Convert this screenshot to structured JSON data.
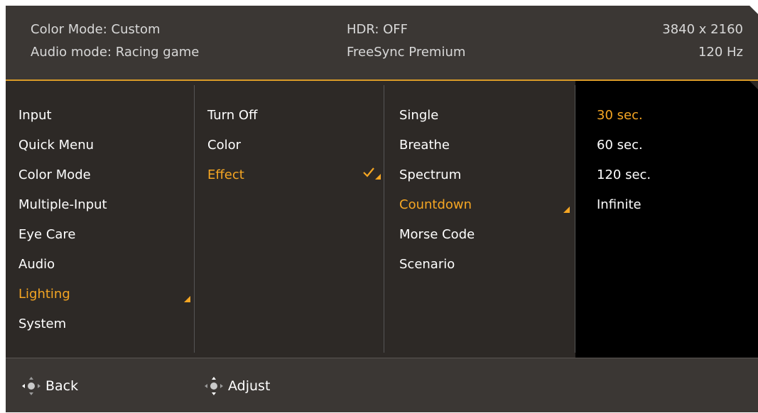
{
  "header": {
    "color_mode": "Color Mode: Custom",
    "audio_mode": "Audio mode: Racing game",
    "hdr": "HDR: OFF",
    "freesync": "FreeSync Premium",
    "resolution": "3840 x 2160",
    "refresh": "120 Hz"
  },
  "menu": {
    "main": [
      "Input",
      "Quick Menu",
      "Color Mode",
      "Multiple-Input",
      "Eye Care",
      "Audio",
      "Lighting",
      "System"
    ],
    "main_selected": "Lighting",
    "lighting": [
      "Turn Off",
      "Color",
      "Effect"
    ],
    "lighting_selected": "Effect",
    "effect": [
      "Single",
      "Breathe",
      "Spectrum",
      "Countdown",
      "Morse Code",
      "Scenario"
    ],
    "effect_selected": "Countdown",
    "countdown": [
      "30 sec.",
      "60 sec.",
      "120 sec.",
      "Infinite"
    ],
    "countdown_selected": "30 sec."
  },
  "footer": {
    "back": "Back",
    "adjust": "Adjust"
  },
  "colors": {
    "accent": "#f5a623",
    "panel": "#2d2926",
    "header": "#3b3734"
  },
  "icons": {
    "check": "check-icon",
    "submenu": "submenu-triangle-icon",
    "joystick": "joystick-icon"
  }
}
